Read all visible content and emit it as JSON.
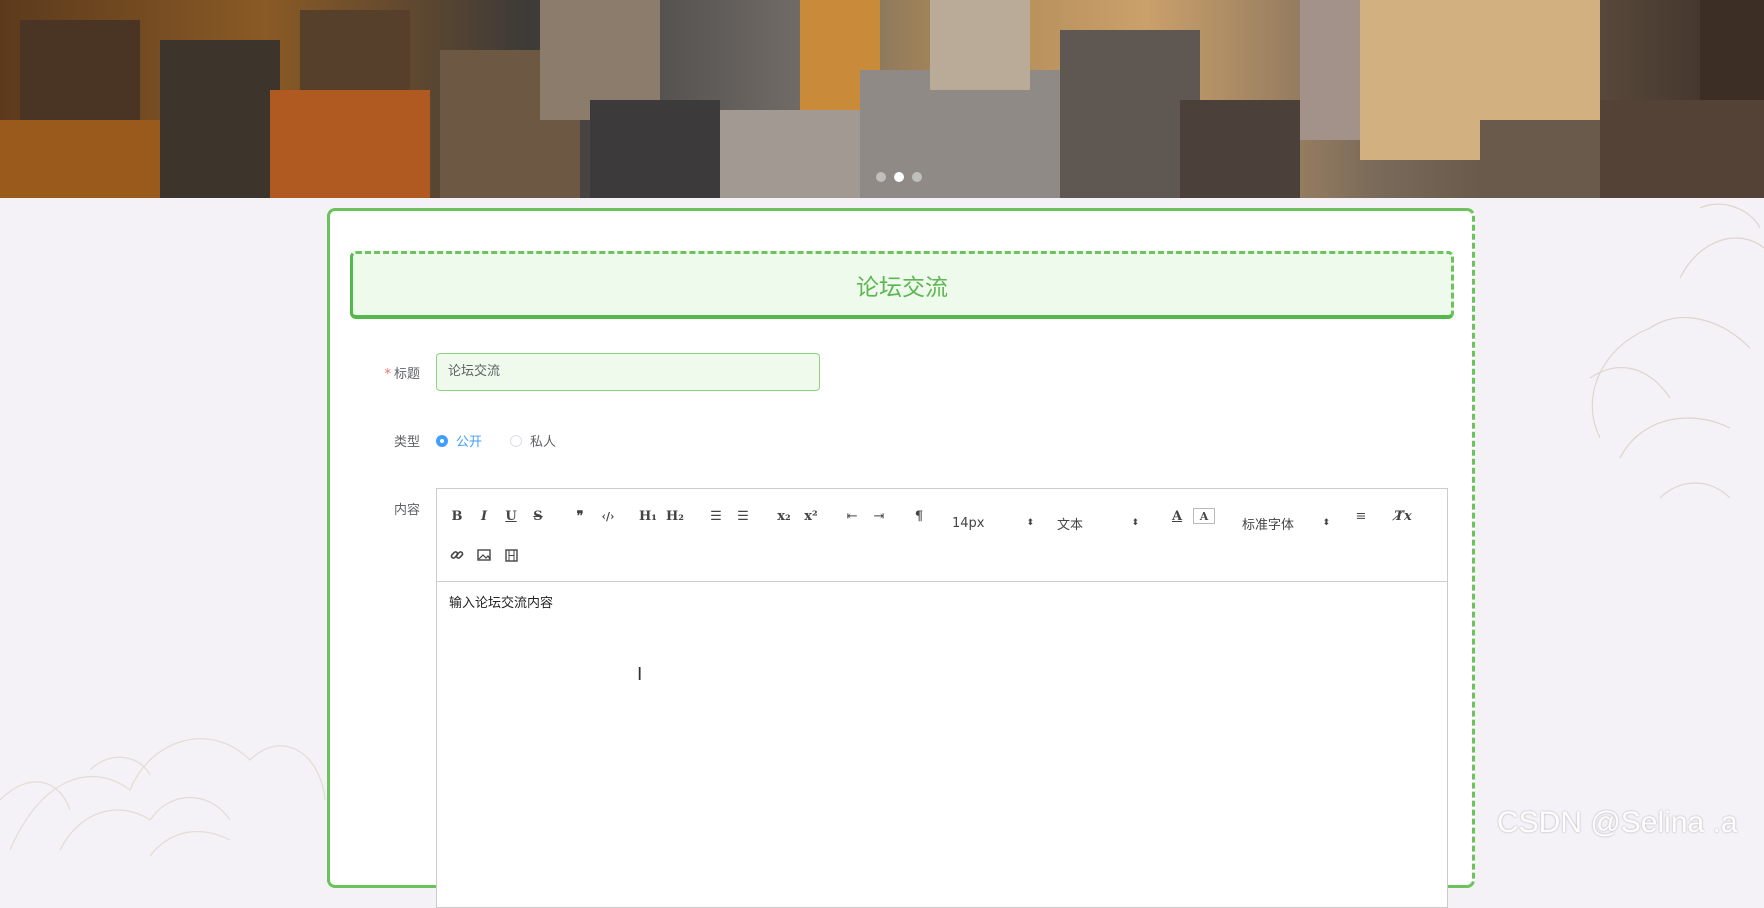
{
  "banner": {
    "slides": 3,
    "active_slide": 2
  },
  "form": {
    "title": "论坛交流",
    "title_field": {
      "label": "标题",
      "required": true,
      "value": "论坛交流"
    },
    "type_field": {
      "label": "类型",
      "options": [
        {
          "label": "公开",
          "checked": true
        },
        {
          "label": "私人",
          "checked": false
        }
      ]
    },
    "content_field": {
      "label": "内容",
      "toolbar": {
        "bold": "B",
        "italic": "I",
        "underline": "U",
        "strike": "S",
        "blockquote": "❞",
        "code": "‹/›",
        "h1": "H₁",
        "h2": "H₂",
        "ordered_list": "☰",
        "bullet_list": "☰",
        "sub": "x₂",
        "super": "x²",
        "outdent": "⇤",
        "indent": "⇥",
        "direction": "¶",
        "size": "14px",
        "header": "文本",
        "font": "标准字体",
        "align": "≡",
        "clean": "T̸x"
      },
      "body_text": "输入论坛交流内容"
    }
  },
  "watermark": "CSDN @Selina .a",
  "colors": {
    "accent": "#6cc35c",
    "radio": "#409eff",
    "required": "#f56c6c"
  }
}
